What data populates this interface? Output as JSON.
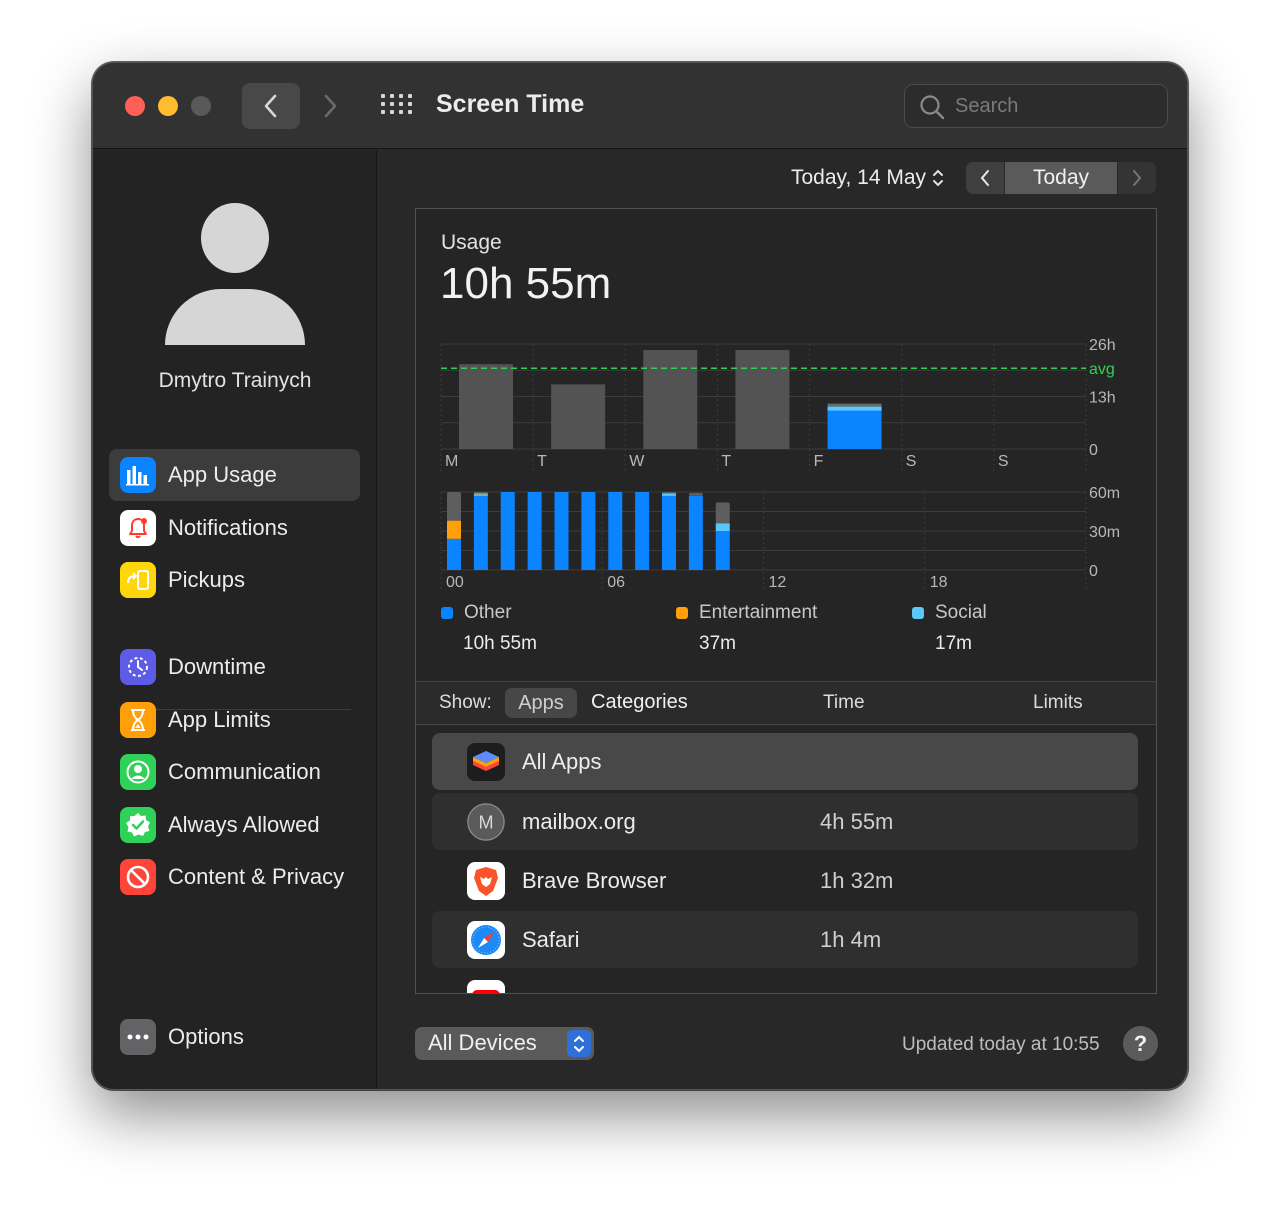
{
  "window": {
    "title": "Screen Time"
  },
  "search": {
    "placeholder": "Search"
  },
  "user": {
    "name": "Dmytro Trainych"
  },
  "sidebar": {
    "items": [
      {
        "label": "App Usage",
        "icon": "bar-chart-icon",
        "color": "#0a84ff",
        "selected": true
      },
      {
        "label": "Notifications",
        "icon": "bell-icon",
        "color": "#ffffff"
      },
      {
        "label": "Pickups",
        "icon": "pickup-icon",
        "color": "#ffd60a"
      },
      {
        "label": "Downtime",
        "icon": "downtime-icon",
        "color": "#5e5ce6"
      },
      {
        "label": "App Limits",
        "icon": "hourglass-icon",
        "color": "#ff9f0a"
      },
      {
        "label": "Communication",
        "icon": "person-circle-icon",
        "color": "#30d158"
      },
      {
        "label": "Always Allowed",
        "icon": "checkmark-badge-icon",
        "color": "#30d158"
      },
      {
        "label": "Content & Privacy",
        "icon": "no-entry-icon",
        "color": "#ff453a"
      }
    ],
    "options": {
      "label": "Options",
      "icon": "ellipsis-icon"
    }
  },
  "date": {
    "label": "Today, 14 May",
    "today_label": "Today"
  },
  "usage": {
    "title": "Usage",
    "total": "10h 55m"
  },
  "chart_data": [
    {
      "type": "bar",
      "categories": [
        "M",
        "T",
        "W",
        "T",
        "F",
        "S",
        "S"
      ],
      "values": [
        21,
        16,
        24.5,
        24.5,
        10.5,
        0,
        0
      ],
      "y_tick_labels": [
        "26h",
        "avg",
        "13h",
        "0"
      ],
      "ylim": [
        0,
        26
      ],
      "average": 20,
      "grid": true,
      "colors": {
        "past": "#535353",
        "today": "#0a84ff",
        "average": "#30d158"
      }
    },
    {
      "type": "bar",
      "stacked": true,
      "x_tick_labels": [
        "00",
        "06",
        "12",
        "18"
      ],
      "y_tick_labels": [
        "60m",
        "30m",
        "0"
      ],
      "ylim": [
        0,
        60
      ],
      "grid": true,
      "hours": [
        0,
        1,
        2,
        3,
        4,
        5,
        6,
        7,
        8,
        9,
        10
      ],
      "series": [
        {
          "name": "Other",
          "color": "#0a84ff",
          "values": [
            24,
            57,
            60,
            60,
            60,
            60,
            60,
            60,
            57,
            57,
            30
          ]
        },
        {
          "name": "Entertainment",
          "color": "#ff9f0a",
          "values": [
            14,
            1,
            0,
            0,
            0,
            0,
            0,
            0,
            0,
            0,
            0
          ]
        },
        {
          "name": "Social",
          "color": "#5ac8fa",
          "values": [
            0,
            1,
            0,
            0,
            0,
            0,
            0,
            0,
            2,
            0,
            6
          ]
        }
      ]
    }
  ],
  "legend": [
    {
      "name": "Other",
      "value": "10h 55m",
      "color": "#0a84ff"
    },
    {
      "name": "Entertainment",
      "value": "37m",
      "color": "#ff9f0a"
    },
    {
      "name": "Social",
      "value": "17m",
      "color": "#5ac8fa"
    }
  ],
  "table": {
    "show_label": "Show:",
    "apps_label": "Apps",
    "categories_label": "Categories",
    "time_header": "Time",
    "limits_header": "Limits",
    "rows": [
      {
        "name": "All Apps",
        "time": "",
        "icon": "stack-icon"
      },
      {
        "name": "mailbox.org",
        "time": "4h 55m",
        "icon": "letter-m-icon"
      },
      {
        "name": "Brave Browser",
        "time": "1h 32m",
        "icon": "brave-lion-icon"
      },
      {
        "name": "Safari",
        "time": "1h 4m",
        "icon": "compass-icon"
      }
    ]
  },
  "footer": {
    "devices_label": "All Devices",
    "updated": "Updated today at 10:55",
    "help_label": "?"
  }
}
